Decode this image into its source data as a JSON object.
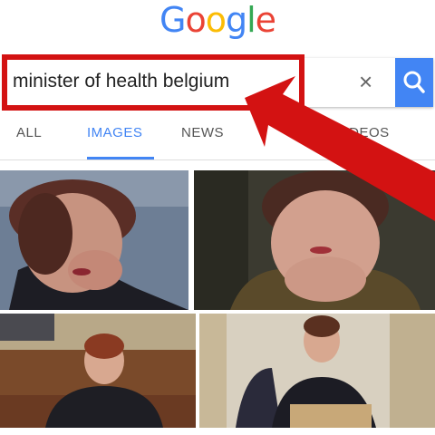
{
  "logo": {
    "letters": [
      "G",
      "o",
      "o",
      "g",
      "l",
      "e"
    ],
    "colors": [
      "#4285f4",
      "#ea4335",
      "#fbbc05",
      "#4285f4",
      "#34a853",
      "#ea4335"
    ]
  },
  "search": {
    "query": "minister of health belgium",
    "clear_symbol": "×"
  },
  "tabs": {
    "all": "ALL",
    "images": "IMAGES",
    "news": "NEWS",
    "videos": "VIDEOS"
  },
  "colors": {
    "accent": "#4285f4",
    "annotation_red": "#d31212"
  },
  "icons": {
    "clear": "close-icon",
    "search": "search-icon",
    "arrow": "red-arrow-annotation"
  },
  "results": {
    "count": 4
  }
}
